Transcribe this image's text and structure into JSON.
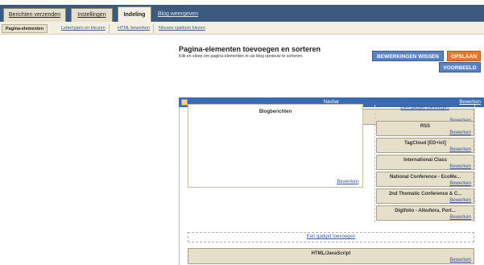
{
  "tabs": [
    {
      "label": "Berichten verzenden"
    },
    {
      "label": "Instellingen"
    },
    {
      "label": "Indeling"
    },
    {
      "label": "Blog weergeven"
    }
  ],
  "subtabs": [
    {
      "label": "Pagina-elementen"
    },
    {
      "label": "Lettertypen en kleuren"
    },
    {
      "label": "HTML bewerken"
    },
    {
      "label": "Nieuwe sjabloon kiezen"
    }
  ],
  "header": {
    "title": "Pagina-elementen toevoegen en sorteren",
    "subtitle": "Klik en sleep om pagina-elementen in uw blog opnieuw te sorteren."
  },
  "buttons": {
    "clear": "BEWERKINGEN WISSEN",
    "save": "OPSLAAN",
    "preview": "VOORBEELD"
  },
  "navbar": {
    "title": "Navbar",
    "edit": "Bewerken"
  },
  "header_widget": {
    "title": "[ED+ict] (Kop)",
    "edit": "Bewerken"
  },
  "main": {
    "title": "Blogberichten",
    "edit": "Bewerken"
  },
  "sidebar": {
    "add_gadget": "Een gadget toevoegen",
    "widgets": [
      {
        "title": "RSS",
        "edit": "Bewerken"
      },
      {
        "title": "TagCloud [ED+ict]",
        "edit": "Bewerken"
      },
      {
        "title": "International Class",
        "edit": "Bewerken"
      },
      {
        "title": "National Conference - EcoMe...",
        "edit": "Bewerken"
      },
      {
        "title": "2nd Thematic Conference & C...",
        "edit": "Bewerken"
      },
      {
        "title": "Digifolio - Albufeira, Port...",
        "edit": "Bewerken"
      }
    ]
  },
  "footer": {
    "add_gadget": "Een gadget toevoegen",
    "widget": {
      "title": "HTML/JavaScript",
      "edit": "Bewerken"
    }
  }
}
